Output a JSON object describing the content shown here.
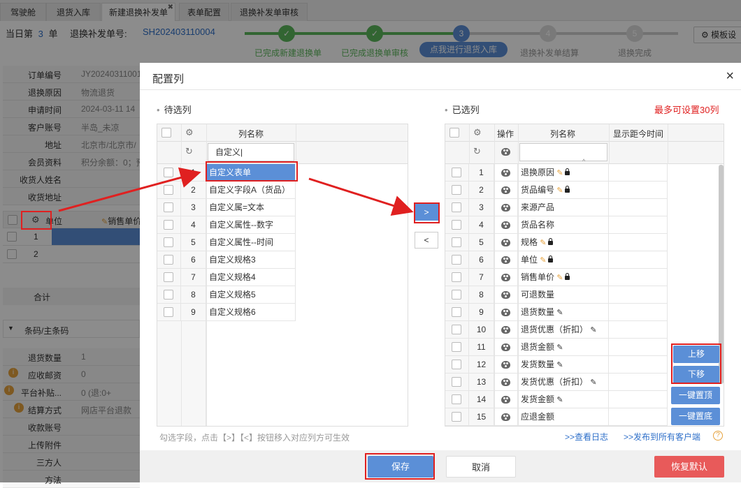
{
  "tabs": [
    "驾驶舱",
    "退货入库",
    "新建退换补发单",
    "表单配置",
    "退换补发单审核"
  ],
  "tab_close": "✖",
  "header": {
    "prefix": "当日第",
    "count": "3",
    "unit": "单",
    "order_label": "退换补发单号:",
    "order_no": "SH202403110004",
    "template_btn": "模板设"
  },
  "steps": [
    {
      "num": "1",
      "label": "已完成新建退换单",
      "state": "done"
    },
    {
      "num": "2",
      "label": "已完成退换单审核",
      "state": "done"
    },
    {
      "num": "3",
      "label": "点我进行退货入库",
      "state": "current"
    },
    {
      "num": "4",
      "label": "退换补发单结算",
      "state": "todo"
    },
    {
      "num": "5",
      "label": "退换完成",
      "state": "todo"
    }
  ],
  "bg_form": [
    {
      "label": "订单编号",
      "value": "JY20240311001"
    },
    {
      "label": "退换原因",
      "value": "物流退货"
    },
    {
      "label": "申请时间",
      "value": "2024-03-11 14"
    },
    {
      "label": "客户账号",
      "value": "半岛_未凉"
    },
    {
      "label": "地址",
      "value": "北京市/北京市/"
    },
    {
      "label": "会员资料",
      "value": "积分余额：0；预"
    },
    {
      "label": "收货人姓名",
      "value": ""
    },
    {
      "label": "收货地址",
      "value": ""
    }
  ],
  "bg_table": {
    "col_unit": "单位",
    "col_price": "销售单价",
    "rows": [
      "1",
      "2"
    ],
    "total": "合计"
  },
  "bg_barcode": "条码/主条码",
  "bg_form2": [
    {
      "label": "退货数量",
      "value": "1"
    },
    {
      "label": "应收邮资",
      "value": "0"
    },
    {
      "label": "平台补贴...",
      "value": "0"
    },
    {
      "label": "结算方式",
      "value": "网店平台退款"
    },
    {
      "label": "收款账号",
      "value": ""
    },
    {
      "label": "上传附件",
      "value": ""
    },
    {
      "label": "三方人",
      "value": ""
    },
    {
      "label": "方法",
      "value": ""
    }
  ],
  "bg_form2_extra": "(退:0+",
  "modal": {
    "title": "配置列",
    "close": "×",
    "left_title": "待选列",
    "right_title": "已选列",
    "max_note": "最多可设置30列",
    "left_header_name": "列名称",
    "search_value": "自定义",
    "left_items": [
      "自定义表单",
      "自定义字段A（货品）",
      "自定义属=文本",
      "自定义属性--数字",
      "自定义属性--时间",
      "自定义规格3",
      "自定义规格4",
      "自定义规格5",
      "自定义规格6"
    ],
    "right_header_op": "操作",
    "right_header_name": "列名称",
    "right_header_time": "显示距今时间",
    "right_items": [
      {
        "name": "退换原因",
        "edit": "y",
        "lock": true
      },
      {
        "name": "货品编号",
        "edit": "y",
        "lock": true
      },
      {
        "name": "来源产品",
        "edit": "",
        "lock": false
      },
      {
        "name": "货品名称",
        "edit": "",
        "lock": false
      },
      {
        "name": "规格",
        "edit": "y",
        "lock": true
      },
      {
        "name": "单位",
        "edit": "y",
        "lock": true
      },
      {
        "name": "销售单价",
        "edit": "y",
        "lock": true
      },
      {
        "name": "可退数量",
        "edit": "",
        "lock": false
      },
      {
        "name": "退货数量",
        "edit": "d",
        "lock": false
      },
      {
        "name": "退货优惠（折扣）",
        "edit": "d",
        "lock": false
      },
      {
        "name": "退货金额",
        "edit": "d",
        "lock": false
      },
      {
        "name": "发货数量",
        "edit": "d",
        "lock": false
      },
      {
        "name": "发货优惠（折扣）",
        "edit": "d",
        "lock": false
      },
      {
        "name": "发货金额",
        "edit": "d",
        "lock": false
      },
      {
        "name": "应退金额",
        "edit": "",
        "lock": false
      }
    ],
    "move_right": ">",
    "move_left": "<",
    "btn_up": "上移",
    "btn_down": "下移",
    "btn_top": "一键置顶",
    "btn_bottom": "一键置底",
    "hint": "勾选字段，点击【>】【<】按钮移入对应列方可生效",
    "link_log": ">>查看日志",
    "link_publish": ">>发布到所有客户端",
    "help": "?",
    "btn_save": "保存",
    "btn_cancel": "取消",
    "btn_reset": "恢复默认"
  },
  "colors": {
    "accent": "#5b8fd7",
    "done": "#5cb85c",
    "danger": "#e85a5a",
    "red": "#e02020"
  }
}
